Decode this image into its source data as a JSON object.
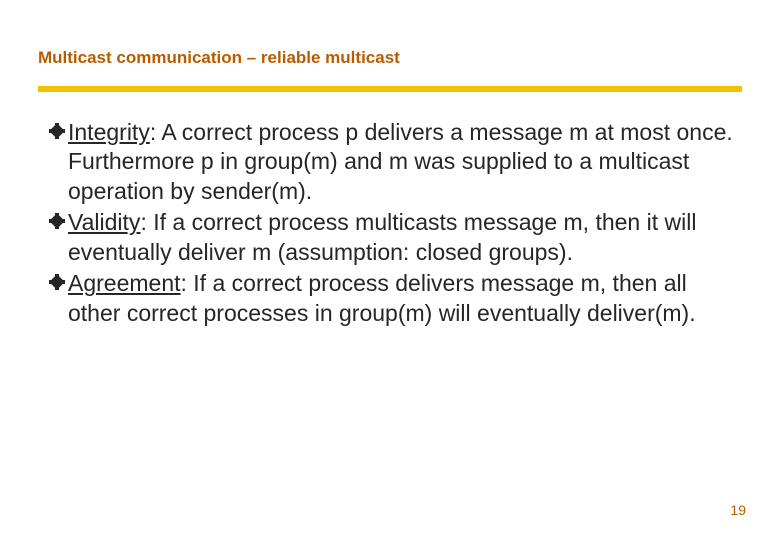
{
  "title": "Multicast communication – reliable multicast",
  "bullets": [
    {
      "term": "Integrity",
      "text": ": A correct process p delivers a message m at most once. Furthermore p in group(m) and m was supplied to a multicast operation by sender(m)."
    },
    {
      "term": "Validity",
      "text": ": If a correct process multicasts message m, then it will eventually deliver m (assumption: closed groups)."
    },
    {
      "term": "Agreement",
      "text": ": If a correct process delivers message m, then all other correct processes in group(m) will eventually deliver(m)."
    }
  ],
  "pageNumber": "19",
  "colors": {
    "accent": "#b85c00",
    "rule": "#f2c200"
  }
}
